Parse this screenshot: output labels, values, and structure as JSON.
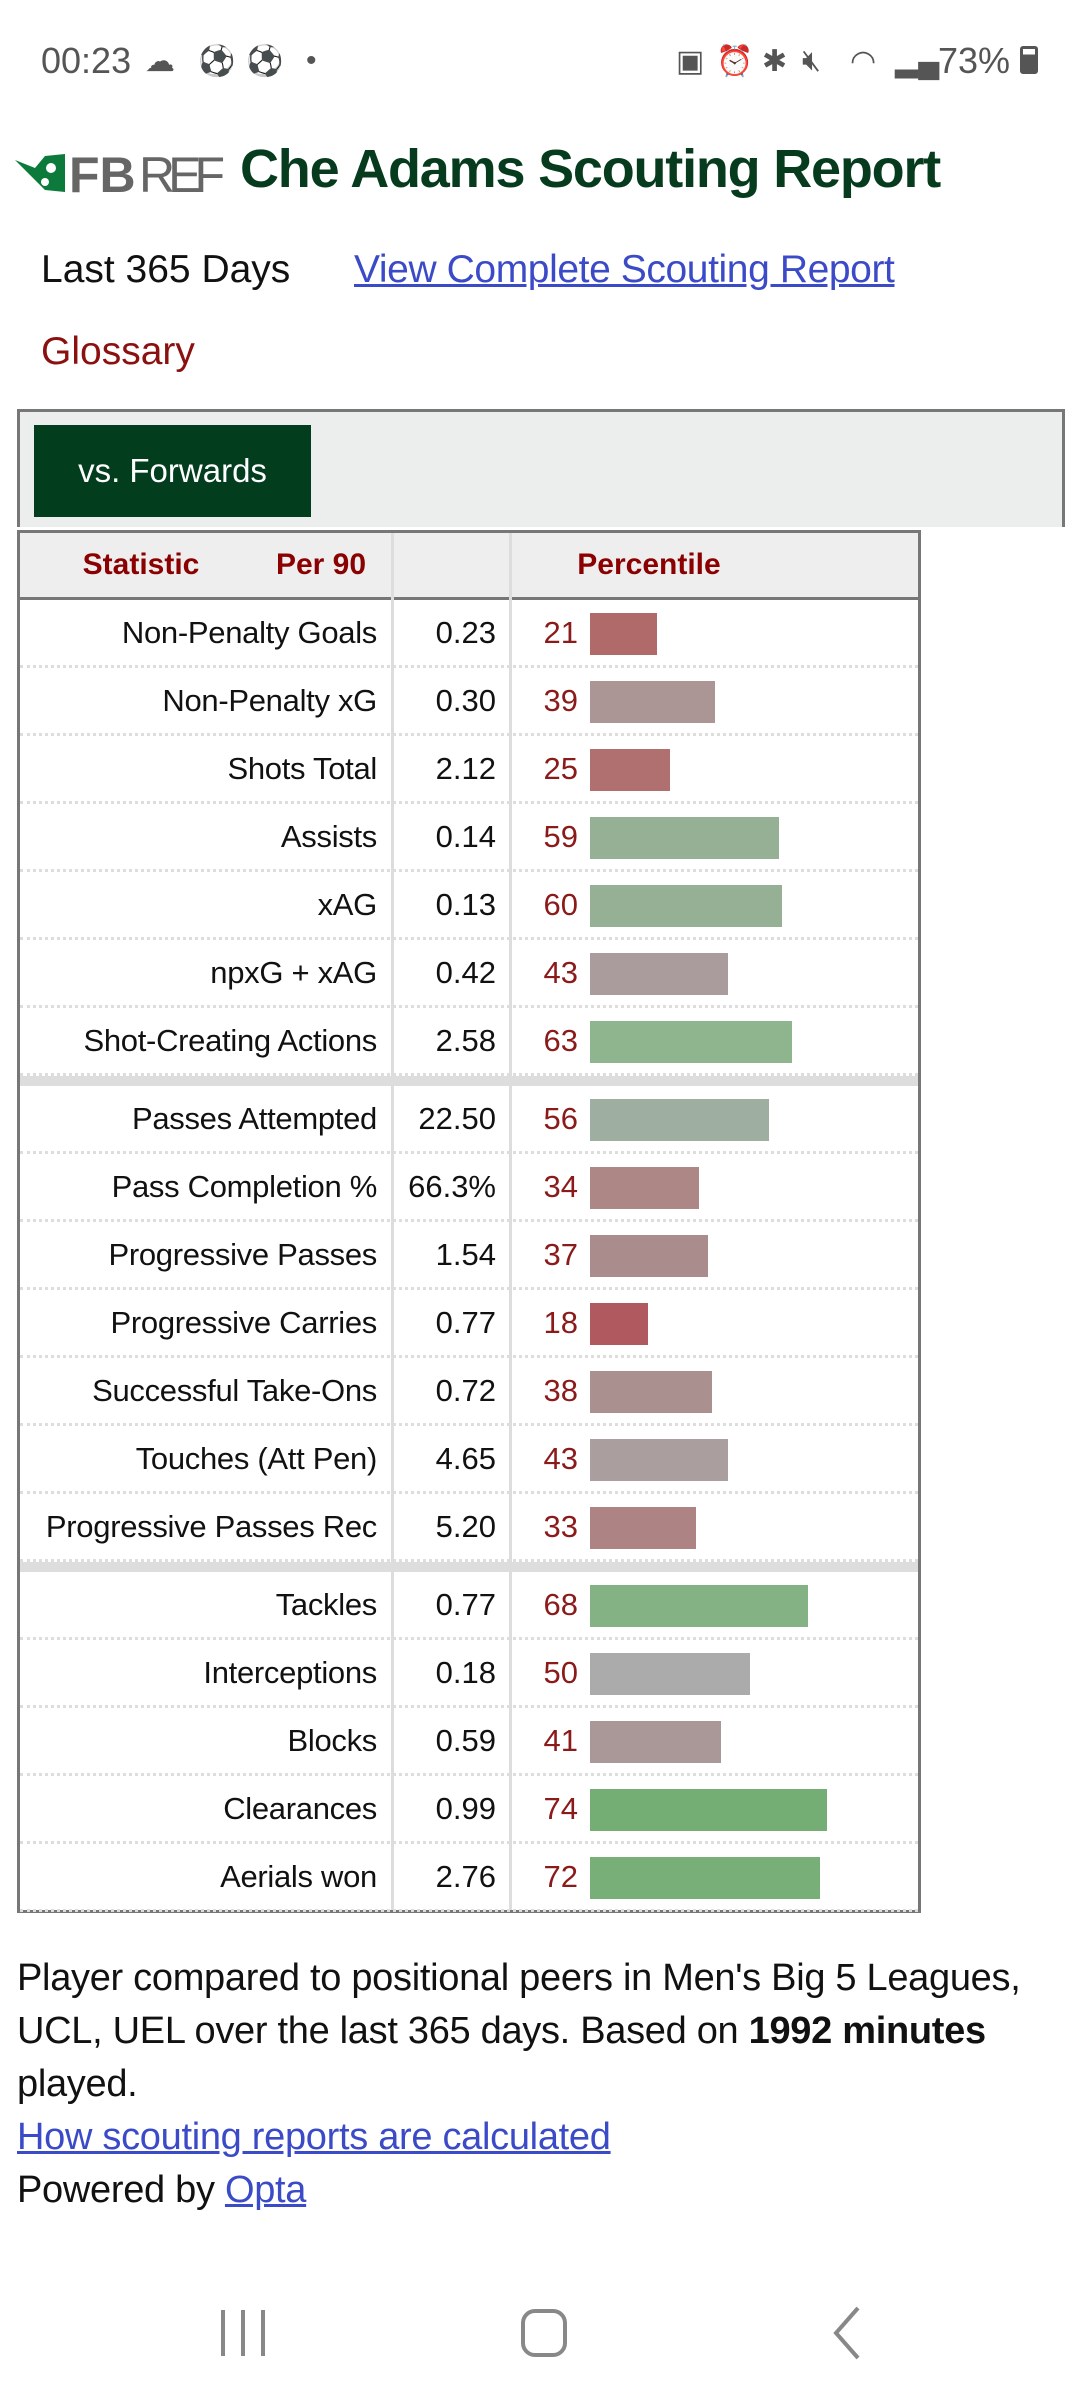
{
  "status_bar": {
    "time": "00:23",
    "battery": "73%",
    "left_icons": [
      "cloud-icon",
      "soccer-ball-icon",
      "soccer-ball-icon",
      "dot-icon"
    ],
    "right_icons": [
      "battery-saver-icon",
      "alarm-icon",
      "bluetooth-icon",
      "mute-icon",
      "wifi-icon",
      "signal-icon"
    ]
  },
  "header": {
    "logo_text": "FBREF",
    "title": "Che Adams Scouting Report"
  },
  "subheader": {
    "period": "Last 365 Days",
    "complete_link": "View Complete Scouting Report",
    "glossary": "Glossary"
  },
  "tab": {
    "label": "vs. Forwards"
  },
  "table": {
    "columns": [
      "Statistic",
      "Per 90",
      "Percentile"
    ],
    "sections": [
      [
        {
          "stat": "Non-Penalty Goals",
          "per90": "0.23",
          "pct": 21,
          "color": "#b06a6a"
        },
        {
          "stat": "Non-Penalty xG",
          "per90": "0.30",
          "pct": 39,
          "color": "#ac9595"
        },
        {
          "stat": "Shots Total",
          "per90": "2.12",
          "pct": 25,
          "color": "#b07070"
        },
        {
          "stat": "Assists",
          "per90": "0.14",
          "pct": 59,
          "color": "#96b096"
        },
        {
          "stat": "xAG",
          "per90": "0.13",
          "pct": 60,
          "color": "#96b096"
        },
        {
          "stat": "npxG + xAG",
          "per90": "0.42",
          "pct": 43,
          "color": "#aa9c9c"
        },
        {
          "stat": "Shot-Creating Actions",
          "per90": "2.58",
          "pct": 63,
          "color": "#8eb58e"
        }
      ],
      [
        {
          "stat": "Passes Attempted",
          "per90": "22.50",
          "pct": 56,
          "color": "#9eaea0"
        },
        {
          "stat": "Pass Completion %",
          "per90": "66.3%",
          "pct": 34,
          "color": "#ad8686"
        },
        {
          "stat": "Progressive Passes",
          "per90": "1.54",
          "pct": 37,
          "color": "#ab8c8c"
        },
        {
          "stat": "Progressive Carries",
          "per90": "0.77",
          "pct": 18,
          "color": "#b05a5f"
        },
        {
          "stat": "Successful Take-Ons",
          "per90": "0.72",
          "pct": 38,
          "color": "#ab9090"
        },
        {
          "stat": "Touches (Att Pen)",
          "per90": "4.65",
          "pct": 43,
          "color": "#ab9e9e"
        },
        {
          "stat": "Progressive Passes Rec",
          "per90": "5.20",
          "pct": 33,
          "color": "#ad8383"
        }
      ],
      [
        {
          "stat": "Tackles",
          "per90": "0.77",
          "pct": 68,
          "color": "#84b284"
        },
        {
          "stat": "Interceptions",
          "per90": "0.18",
          "pct": 50,
          "color": "#ababab"
        },
        {
          "stat": "Blocks",
          "per90": "0.59",
          "pct": 41,
          "color": "#aa9898"
        },
        {
          "stat": "Clearances",
          "per90": "0.99",
          "pct": 74,
          "color": "#74ae74"
        },
        {
          "stat": "Aerials won",
          "per90": "2.76",
          "pct": 72,
          "color": "#78ae78"
        }
      ]
    ]
  },
  "footer": {
    "text_before": "Player compared to positional peers in Men's Big 5 Leagues, UCL, UEL over the last 365 days. Based on ",
    "minutes": "1992 minutes",
    "text_after": " played.",
    "how_link": "How scouting reports are calculated",
    "powered_by": "Powered by ",
    "opta_link": "Opta"
  },
  "colors": {
    "brand_green": "#063b1e",
    "tab_green": "#023d1e",
    "header_red": "#8b0000",
    "link_blue": "#3b4bc8"
  }
}
